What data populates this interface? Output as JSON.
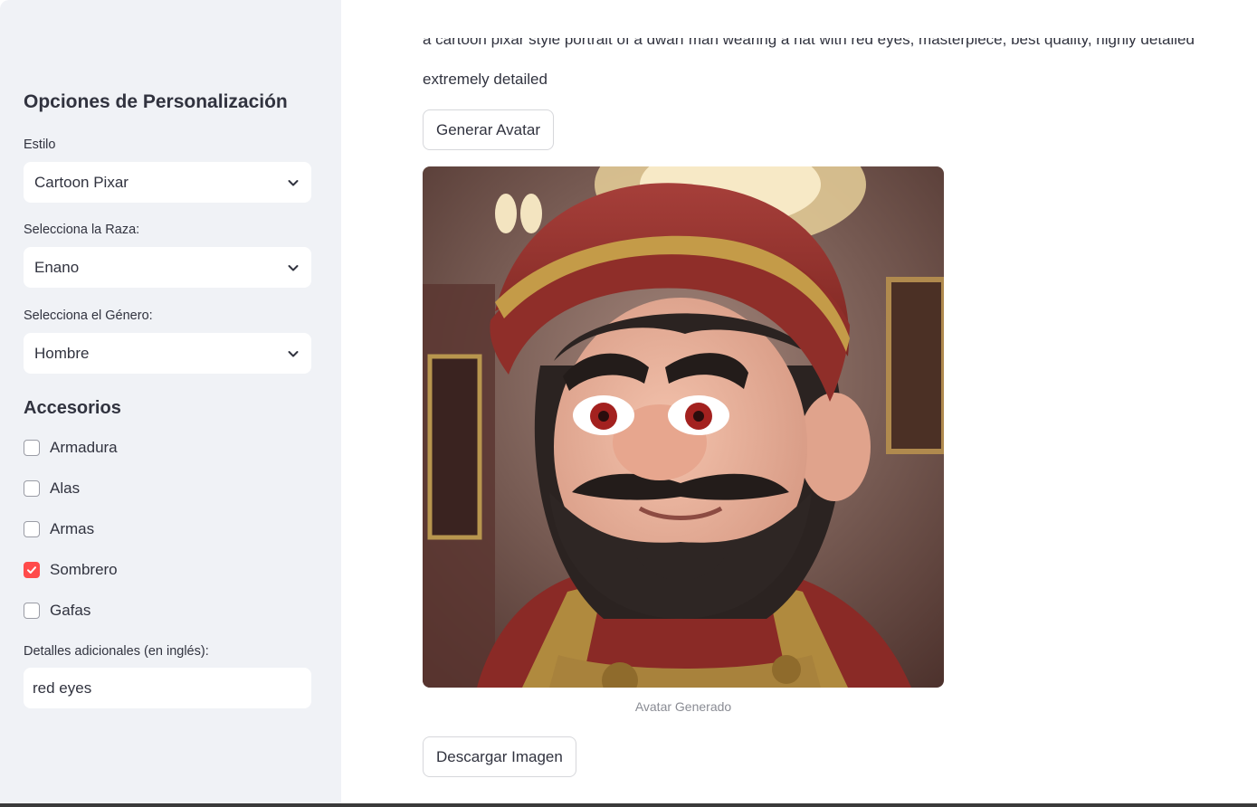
{
  "sidebar": {
    "title": "Opciones de Personalización",
    "style": {
      "label": "Estilo",
      "value": "Cartoon Pixar"
    },
    "race": {
      "label": "Selecciona la Raza:",
      "value": "Enano"
    },
    "gender": {
      "label": "Selecciona el Género:",
      "value": "Hombre"
    },
    "accessories_title": "Accesorios",
    "accessories": [
      {
        "label": "Armadura",
        "checked": false
      },
      {
        "label": "Alas",
        "checked": false
      },
      {
        "label": "Armas",
        "checked": false
      },
      {
        "label": "Sombrero",
        "checked": true
      },
      {
        "label": "Gafas",
        "checked": false
      }
    ],
    "details": {
      "label": "Detalles adicionales (en inglés):",
      "value": "red eyes"
    }
  },
  "main": {
    "prompt_partial": "a cartoon pixar style portrait of a dwarf man wearing a hat with red eyes, masterpiece, best quality, highly detailed",
    "prompt_tail": "extremely detailed",
    "generate_label": "Generar Avatar",
    "image_caption": "Avatar Generado",
    "download_label": "Descargar Imagen"
  },
  "colors": {
    "accent": "#ff4b4b",
    "sidebar_bg": "#f0f2f6",
    "text": "#31333f"
  }
}
